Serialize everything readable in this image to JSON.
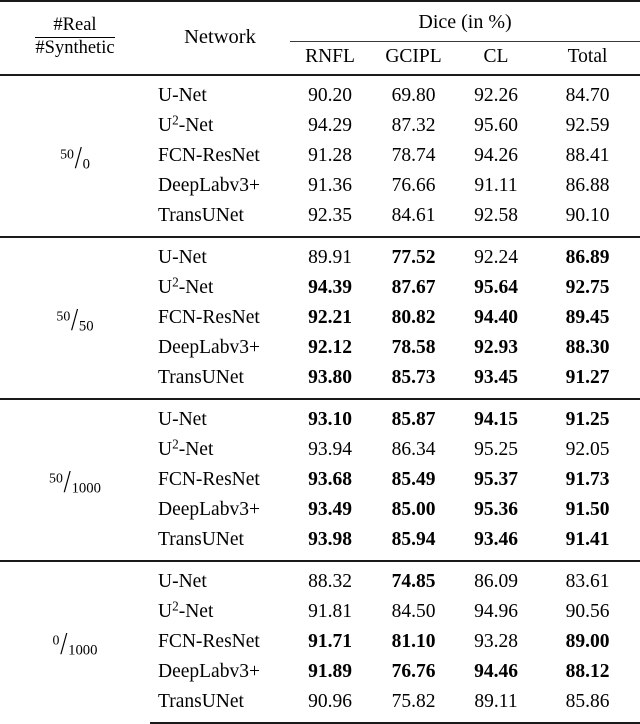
{
  "table": {
    "header": {
      "ratio_numerator": "#Real",
      "ratio_denominator": "#Synthetic",
      "network_label": "Network",
      "group_label": "Dice (in %)",
      "columns": [
        "RNFL",
        "GCIPL",
        "CL",
        "Total"
      ]
    },
    "blocks": [
      {
        "ratio_num": "50",
        "ratio_slash": "/",
        "ratio_den": "0",
        "rows": [
          {
            "network": "U-Net",
            "network_sup": "",
            "values": [
              "90.20",
              "69.80",
              "92.26",
              "84.70"
            ],
            "bold": [
              false,
              false,
              false,
              false
            ]
          },
          {
            "network": "U",
            "network_sup": "2",
            "network_tail": "-Net",
            "values": [
              "94.29",
              "87.32",
              "95.60",
              "92.59"
            ],
            "bold": [
              false,
              false,
              false,
              false
            ]
          },
          {
            "network": "FCN-ResNet",
            "network_sup": "",
            "values": [
              "91.28",
              "78.74",
              "94.26",
              "88.41"
            ],
            "bold": [
              false,
              false,
              false,
              false
            ]
          },
          {
            "network": "DeepLabv3+",
            "network_sup": "",
            "values": [
              "91.36",
              "76.66",
              "91.11",
              "86.88"
            ],
            "bold": [
              false,
              false,
              false,
              false
            ]
          },
          {
            "network": "TransUNet",
            "network_sup": "",
            "values": [
              "92.35",
              "84.61",
              "92.58",
              "90.10"
            ],
            "bold": [
              false,
              false,
              false,
              false
            ]
          }
        ]
      },
      {
        "ratio_num": "50",
        "ratio_slash": "/",
        "ratio_den": "50",
        "rows": [
          {
            "network": "U-Net",
            "network_sup": "",
            "values": [
              "89.91",
              "77.52",
              "92.24",
              "86.89"
            ],
            "bold": [
              false,
              true,
              false,
              true
            ]
          },
          {
            "network": "U",
            "network_sup": "2",
            "network_tail": "-Net",
            "values": [
              "94.39",
              "87.67",
              "95.64",
              "92.75"
            ],
            "bold": [
              true,
              true,
              true,
              true
            ]
          },
          {
            "network": "FCN-ResNet",
            "network_sup": "",
            "values": [
              "92.21",
              "80.82",
              "94.40",
              "89.45"
            ],
            "bold": [
              true,
              true,
              true,
              true
            ]
          },
          {
            "network": "DeepLabv3+",
            "network_sup": "",
            "values": [
              "92.12",
              "78.58",
              "92.93",
              "88.30"
            ],
            "bold": [
              true,
              true,
              true,
              true
            ]
          },
          {
            "network": "TransUNet",
            "network_sup": "",
            "values": [
              "93.80",
              "85.73",
              "93.45",
              "91.27"
            ],
            "bold": [
              true,
              true,
              true,
              true
            ]
          }
        ]
      },
      {
        "ratio_num": "50",
        "ratio_slash": "/",
        "ratio_den": "1000",
        "rows": [
          {
            "network": "U-Net",
            "network_sup": "",
            "values": [
              "93.10",
              "85.87",
              "94.15",
              "91.25"
            ],
            "bold": [
              true,
              true,
              true,
              true
            ]
          },
          {
            "network": "U",
            "network_sup": "2",
            "network_tail": "-Net",
            "values": [
              "93.94",
              "86.34",
              "95.25",
              "92.05"
            ],
            "bold": [
              false,
              false,
              false,
              false
            ]
          },
          {
            "network": "FCN-ResNet",
            "network_sup": "",
            "values": [
              "93.68",
              "85.49",
              "95.37",
              "91.73"
            ],
            "bold": [
              true,
              true,
              true,
              true
            ]
          },
          {
            "network": "DeepLabv3+",
            "network_sup": "",
            "values": [
              "93.49",
              "85.00",
              "95.36",
              "91.50"
            ],
            "bold": [
              true,
              true,
              true,
              true
            ]
          },
          {
            "network": "TransUNet",
            "network_sup": "",
            "values": [
              "93.98",
              "85.94",
              "93.46",
              "91.41"
            ],
            "bold": [
              true,
              true,
              true,
              true
            ]
          }
        ]
      },
      {
        "ratio_num": "0",
        "ratio_slash": "/",
        "ratio_den": "1000",
        "rows": [
          {
            "network": "U-Net",
            "network_sup": "",
            "values": [
              "88.32",
              "74.85",
              "86.09",
              "83.61"
            ],
            "bold": [
              false,
              true,
              false,
              false
            ]
          },
          {
            "network": "U",
            "network_sup": "2",
            "network_tail": "-Net",
            "values": [
              "91.81",
              "84.50",
              "94.96",
              "90.56"
            ],
            "bold": [
              false,
              false,
              false,
              false
            ]
          },
          {
            "network": "FCN-ResNet",
            "network_sup": "",
            "values": [
              "91.71",
              "81.10",
              "93.28",
              "89.00"
            ],
            "bold": [
              true,
              true,
              false,
              true
            ]
          },
          {
            "network": "DeepLabv3+",
            "network_sup": "",
            "values": [
              "91.89",
              "76.76",
              "94.46",
              "88.12"
            ],
            "bold": [
              true,
              true,
              true,
              true
            ]
          },
          {
            "network": "TransUNet",
            "network_sup": "",
            "values": [
              "90.96",
              "75.82",
              "89.11",
              "85.86"
            ],
            "bold": [
              false,
              false,
              false,
              false
            ]
          }
        ]
      }
    ]
  }
}
